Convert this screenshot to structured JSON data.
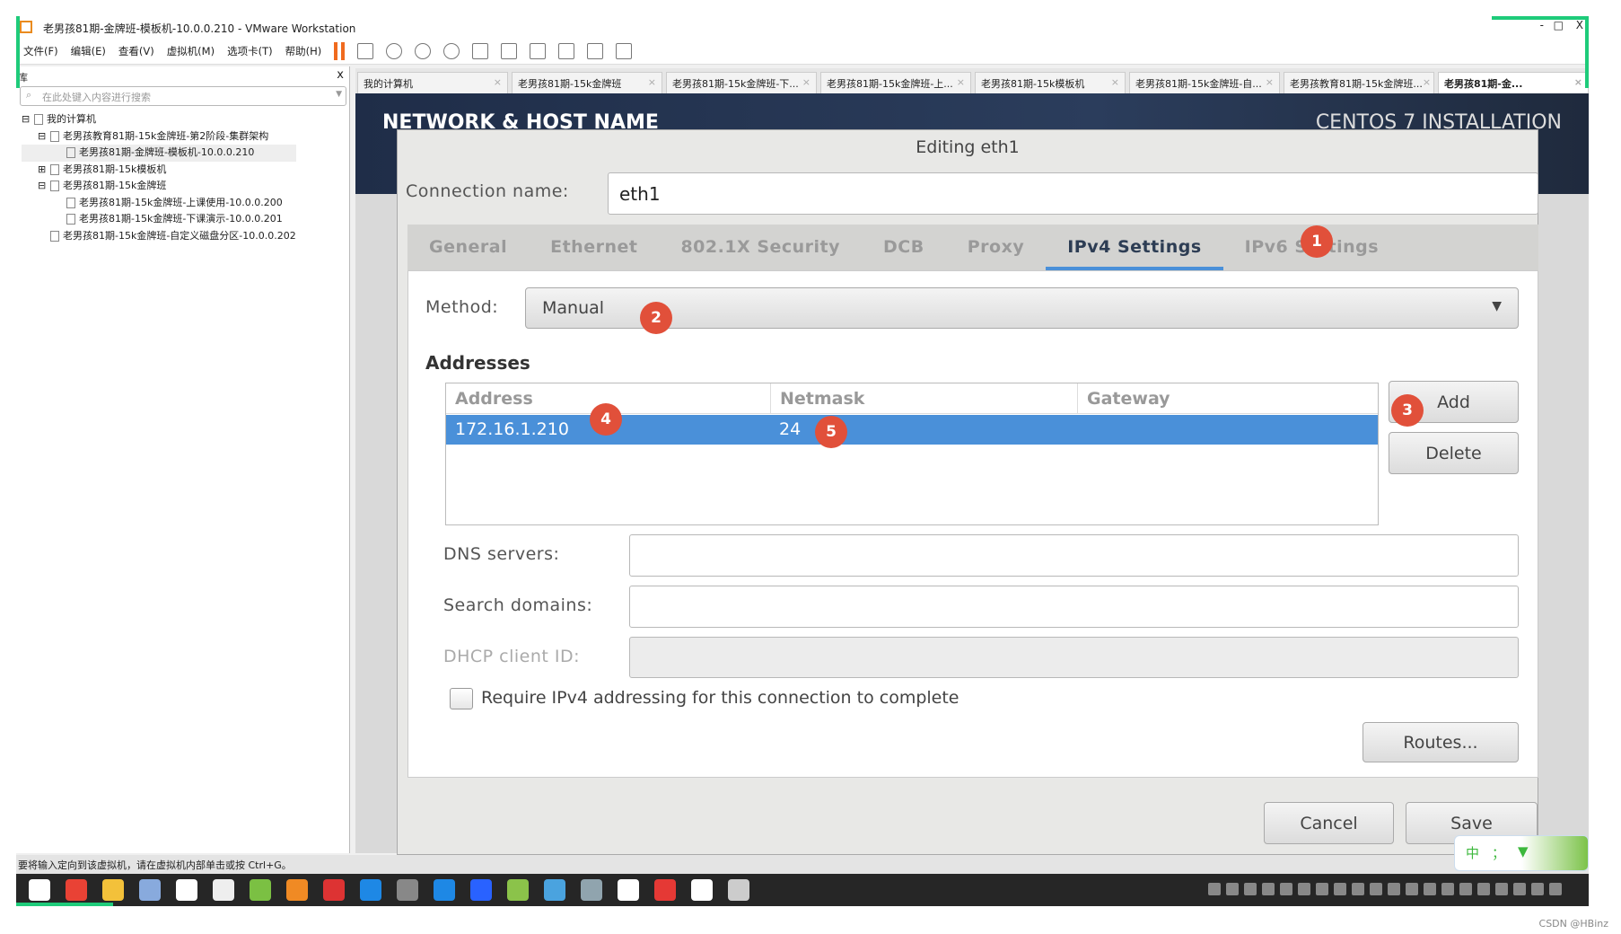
{
  "window": {
    "title": "老男孩81期-金牌班-模板机-10.0.0.210 - VMware Workstation",
    "controls": [
      "-",
      "□",
      "X"
    ]
  },
  "menu": [
    "文件(F)",
    "编辑(E)",
    "查看(V)",
    "虚拟机(M)",
    "选项卡(T)",
    "帮助(H)"
  ],
  "library": {
    "title": "库",
    "close": "x",
    "search_placeholder": "在此处键入内容进行搜索",
    "tree": [
      {
        "label": "我的计算机",
        "level": 0,
        "toggle": "⊟"
      },
      {
        "label": "老男孩教育81期-15k金牌班-第2阶段-集群架构",
        "level": 1,
        "toggle": "⊟"
      },
      {
        "label": "老男孩81期-金牌班-模板机-10.0.0.210",
        "level": 2,
        "toggle": "",
        "selected": true
      },
      {
        "label": "老男孩81期-15k模板机",
        "level": 1,
        "toggle": "⊞"
      },
      {
        "label": "老男孩81期-15k金牌班",
        "level": 1,
        "toggle": "⊟"
      },
      {
        "label": "老男孩81期-15k金牌班-上课使用-10.0.0.200",
        "level": 2,
        "toggle": ""
      },
      {
        "label": "老男孩81期-15k金牌班-下课演示-10.0.0.201",
        "level": 2,
        "toggle": ""
      },
      {
        "label": "老男孩81期-15k金牌班-自定义磁盘分区-10.0.0.202",
        "level": 1,
        "toggle": ""
      }
    ]
  },
  "vm_tabs": [
    "我的计算机",
    "老男孩81期-15k金牌班",
    "老男孩81期-15k金牌班-下...",
    "老男孩81期-15k金牌班-上...",
    "老男孩81期-15k模板机",
    "老男孩81期-15k金牌班-自...",
    "老男孩教育81期-15k金牌班...",
    "老男孩81期-金..."
  ],
  "installer": {
    "left_title": "NETWORK & HOST NAME",
    "right_title": "CENTOS 7 INSTALLATION"
  },
  "dialog": {
    "title": "Editing eth1",
    "connection_label": "Connection name:",
    "connection_value": "eth1",
    "tabs": [
      "General",
      "Ethernet",
      "802.1X Security",
      "DCB",
      "Proxy",
      "IPv4 Settings",
      "IPv6 Settings"
    ],
    "active_tab": "IPv4 Settings",
    "method_label": "Method:",
    "method_value": "Manual",
    "addresses_heading": "Addresses",
    "columns": [
      "Address",
      "Netmask",
      "Gateway"
    ],
    "rows": [
      {
        "address": "172.16.1.210",
        "netmask": "24",
        "gateway": ""
      }
    ],
    "add": "Add",
    "delete": "Delete",
    "dns_label": "DNS servers:",
    "dns_value": "",
    "search_label": "Search domains:",
    "search_value": "",
    "dhcp_label": "DHCP client ID:",
    "dhcp_value": "",
    "require_label": "Require IPv4 addressing for this connection to complete",
    "require_checked": false,
    "routes": "Routes...",
    "cancel": "Cancel",
    "save": "Save"
  },
  "badges": [
    "1",
    "2",
    "3",
    "4",
    "5"
  ],
  "status_text": "要将输入定向到该虚拟机，请在虚拟机内部单击或按 Ctrl+G。",
  "ime": {
    "lang": "中",
    "punct": "；",
    "icon": "shirt-icon"
  },
  "watermark": "CSDN @HBinz",
  "colors": {
    "accent": "#4a90d9",
    "badge": "#e1503a",
    "selection": "#4a90d9",
    "frame": "#1ecb7a"
  }
}
